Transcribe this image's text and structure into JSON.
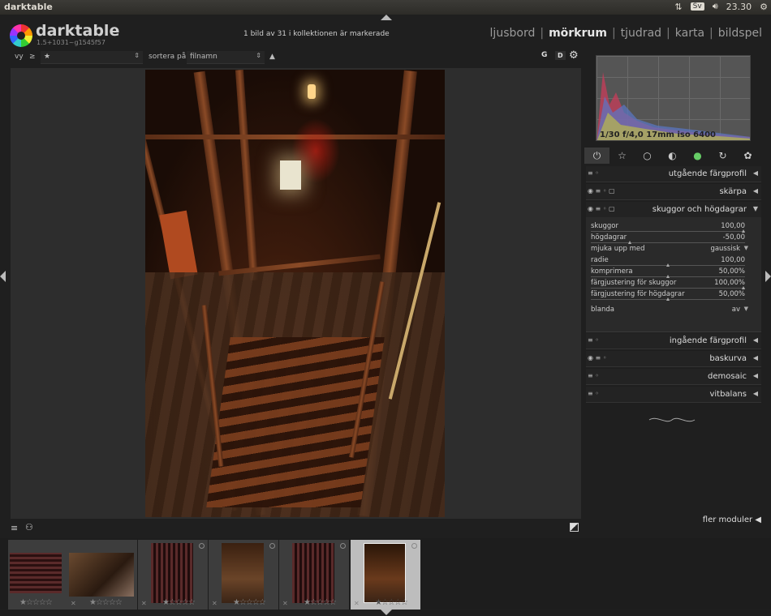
{
  "window": {
    "title": "darktable",
    "keyboard_layout": "Sv",
    "clock": "23.30"
  },
  "header": {
    "app_name": "darktable",
    "version": "1.5+1031~g1545f57",
    "collection_info": "1 bild av 31 i kollektionen är markerade",
    "views": [
      "ljusbord",
      "mörkrum",
      "tjudrad",
      "karta",
      "bildspel"
    ],
    "active_view": "mörkrum"
  },
  "toolbar": {
    "view_label": "vy",
    "comparator": "≥",
    "rating_filter": "★",
    "sort_label": "sortera på",
    "sort_value": "filnamn",
    "sort_direction": "▲",
    "btn_g": "G",
    "btn_d": "D"
  },
  "histogram": {
    "info": "1/30 f/4,0 17mm iso 6400"
  },
  "module_groups": [
    "power",
    "favorites",
    "basic",
    "tone",
    "color",
    "correct",
    "effect"
  ],
  "modules": [
    {
      "name": "utgående färgprofil",
      "icons": "≡ ◦"
    },
    {
      "name": "skärpa",
      "icons": "◉ ≡ ◦ ▢"
    },
    {
      "name": "skuggor och högdagrar",
      "icons": "◉ ≡ ◦ ▢",
      "expanded": true
    },
    {
      "name": "ingående färgprofil",
      "icons": "≡ ◦"
    },
    {
      "name": "baskurva",
      "icons": "◉ ≡ ◦"
    },
    {
      "name": "demosaic",
      "icons": "≡ ◦"
    },
    {
      "name": "vitbalans",
      "icons": "≡ ◦"
    }
  ],
  "shadows_highlights": {
    "skuggor": {
      "label": "skuggor",
      "value": "100,00"
    },
    "hogdagrar": {
      "label": "högdagrar",
      "value": "-50,00"
    },
    "mjuka": {
      "label": "mjuka upp med",
      "value": "gaussisk"
    },
    "radie": {
      "label": "radie",
      "value": "100,00"
    },
    "komprimera": {
      "label": "komprimera",
      "value": "50,00%"
    },
    "farg_skuggor": {
      "label": "färgjustering för skuggor",
      "value": "100,00%"
    },
    "farg_hogdagrar": {
      "label": "färgjustering för högdagrar",
      "value": "50,00%"
    },
    "blanda": {
      "label": "blanda",
      "value": "av"
    }
  },
  "more_modules": "fler moduler",
  "filmstrip": {
    "thumbs": [
      {
        "stars": "★☆☆☆☆"
      },
      {
        "stars": "★☆☆☆☆"
      },
      {
        "stars": "★☆☆☆☆"
      },
      {
        "stars": "★☆☆☆☆"
      },
      {
        "stars": "★☆☆☆☆"
      },
      {
        "stars": "★☆☆☆☆"
      }
    ],
    "selected_index": 5
  },
  "colors": {
    "background": "#1f1f1f",
    "panel": "#232323",
    "center_bg": "#2d2d2d",
    "text": "#dddddd"
  }
}
